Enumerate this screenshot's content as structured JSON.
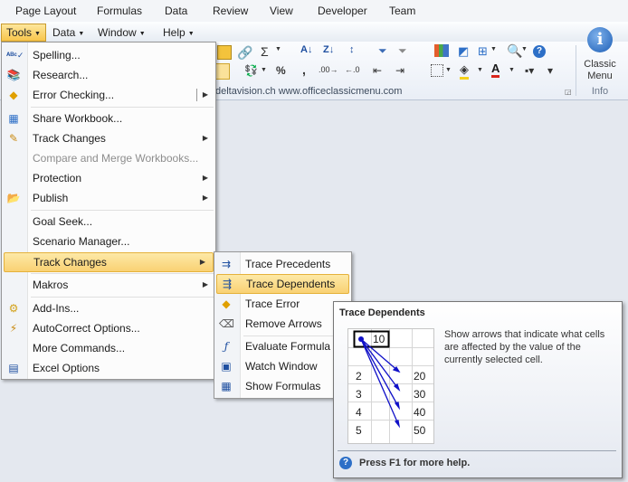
{
  "ribbon_tabs": [
    "Page Layout",
    "Formulas",
    "Data",
    "Review",
    "View",
    "Developer",
    "Team"
  ],
  "menubar": {
    "items": [
      {
        "label": "Tools",
        "active": true
      },
      {
        "label": "Data"
      },
      {
        "label": "Window"
      },
      {
        "label": "Help"
      }
    ]
  },
  "ribbon": {
    "address_text": "deltavision.ch   www.officeclassicmenu.com",
    "sigma": "Σ",
    "percent": "%",
    "comma": ",",
    "classic_menu_label": "Classic Menu",
    "info_group_label": "Info"
  },
  "tools_menu": {
    "items": [
      {
        "label": "Spelling...",
        "icon": "spelling-icon"
      },
      {
        "label": "Research...",
        "icon": "research-icon"
      },
      {
        "label": "Error Checking...",
        "icon": "error-checking-icon",
        "submenu": true
      },
      {
        "label": "Share Workbook...",
        "icon": "share-workbook-icon"
      },
      {
        "label": "Track Changes",
        "icon": "track-changes-icon",
        "submenu": true
      },
      {
        "label": "Compare and Merge Workbooks...",
        "disabled": true
      },
      {
        "label": "Protection",
        "submenu": true
      },
      {
        "label": "Publish",
        "icon": "publish-icon",
        "submenu": true
      },
      {
        "label": "Goal Seek..."
      },
      {
        "label": "Scenario Manager..."
      },
      {
        "label": "Track Changes",
        "submenu": true,
        "highlighted": true
      },
      {
        "label": "Makros",
        "submenu": true
      },
      {
        "label": "Add-Ins...",
        "icon": "add-ins-icon"
      },
      {
        "label": "AutoCorrect Options...",
        "icon": "autocorrect-icon"
      },
      {
        "label": "More Commands..."
      },
      {
        "label": "Excel Options",
        "icon": "excel-options-icon"
      }
    ]
  },
  "sub_menu": {
    "items": [
      {
        "label": "Trace Precedents",
        "icon": "trace-precedents-icon"
      },
      {
        "label": "Trace Dependents",
        "icon": "trace-dependents-icon",
        "highlighted": true
      },
      {
        "label": "Trace Error",
        "icon": "trace-error-icon"
      },
      {
        "label": "Remove Arrows",
        "icon": "remove-arrows-icon"
      },
      {
        "label": "Evaluate Formula",
        "icon": "evaluate-formula-icon"
      },
      {
        "label": "Watch Window",
        "icon": "watch-window-icon"
      },
      {
        "label": "Show Formulas",
        "icon": "show-formulas-icon"
      }
    ]
  },
  "tooltip": {
    "title": "Trace Dependents",
    "description": "Show arrows that indicate what cells are affected by the value of the currently selected cell.",
    "help": "Press F1 for more help.",
    "example": {
      "source": "10",
      "rows": [
        [
          "2",
          "20"
        ],
        [
          "3",
          "30"
        ],
        [
          "4",
          "40"
        ],
        [
          "5",
          "50"
        ]
      ]
    }
  },
  "colors": {
    "highlight": "#f9d173",
    "accent": "#1f4fa0"
  }
}
